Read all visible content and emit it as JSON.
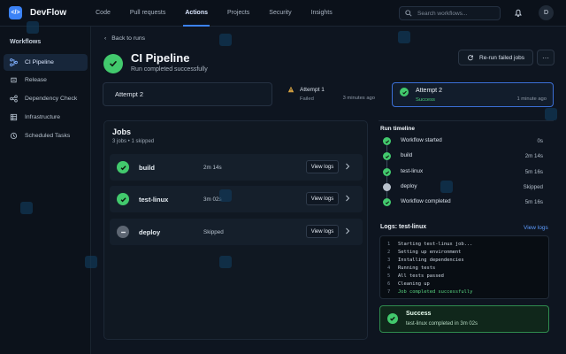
{
  "app": {
    "name": "DevFlow",
    "avatar_initial": "D"
  },
  "nav": {
    "items": [
      "Code",
      "Pull requests",
      "Actions",
      "Projects",
      "Security",
      "Insights"
    ],
    "active": "Actions"
  },
  "search": {
    "placeholder": "Search workflows..."
  },
  "sidebar": {
    "title": "Workflows",
    "items": [
      {
        "label": "CI Pipeline",
        "icon": "workflow-icon",
        "active": true
      },
      {
        "label": "Release",
        "icon": "release-icon",
        "active": false
      },
      {
        "label": "Dependency Check",
        "icon": "dependency-icon",
        "active": false
      },
      {
        "label": "Infrastructure",
        "icon": "infrastructure-icon",
        "active": false
      },
      {
        "label": "Scheduled Tasks",
        "icon": "clock-icon",
        "active": false
      }
    ]
  },
  "header": {
    "back_label": "Back to runs",
    "title": "CI Pipeline",
    "subtitle": "Run completed successfully",
    "rerun_label": "Re-run failed jobs",
    "more_label": "···"
  },
  "attempts": {
    "selected": "Attempt 2",
    "items": [
      {
        "title": "Attempt 1",
        "status": "Failed",
        "time": "3 minutes ago"
      },
      {
        "title": "Attempt 2",
        "status": "Success",
        "time": "1 minute ago"
      }
    ]
  },
  "jobs": {
    "title": "Jobs",
    "summary": "3 jobs • 1 skipped",
    "items": [
      {
        "name": "build",
        "time": "2m 14s",
        "status": "success",
        "view_label": "View logs"
      },
      {
        "name": "test-linux",
        "time": "3m 02s",
        "status": "success",
        "view_label": "View logs"
      },
      {
        "name": "deploy",
        "time": "Skipped",
        "status": "skipped",
        "view_label": "View logs"
      }
    ]
  },
  "timeline": {
    "title": "Run timeline",
    "items": [
      {
        "label": "Workflow started",
        "time": "0s",
        "status": "success"
      },
      {
        "label": "build",
        "time": "2m 14s",
        "status": "success"
      },
      {
        "label": "test-linux",
        "time": "5m 16s",
        "status": "success"
      },
      {
        "label": "deploy",
        "time": "Skipped",
        "status": "skipped"
      },
      {
        "label": "Workflow completed",
        "time": "5m 16s",
        "status": "success"
      }
    ]
  },
  "logs": {
    "title": "Logs: test-linux",
    "view_label": "View logs",
    "lines": [
      {
        "num": "1",
        "text": "Starting test-linux job..."
      },
      {
        "num": "2",
        "text": "Setting up environment"
      },
      {
        "num": "3",
        "text": "Installing dependencies"
      },
      {
        "num": "4",
        "text": "Running tests"
      },
      {
        "num": "5",
        "text": "All tests passed"
      },
      {
        "num": "6",
        "text": "Cleaning up"
      },
      {
        "num": "7",
        "text": "Job completed successfully"
      }
    ]
  },
  "result": {
    "title": "Success",
    "message": "test-linux completed in 3m 02s"
  },
  "colors": {
    "accent": "#3b82f6",
    "success": "#42c96d",
    "background": "#0e1520"
  }
}
